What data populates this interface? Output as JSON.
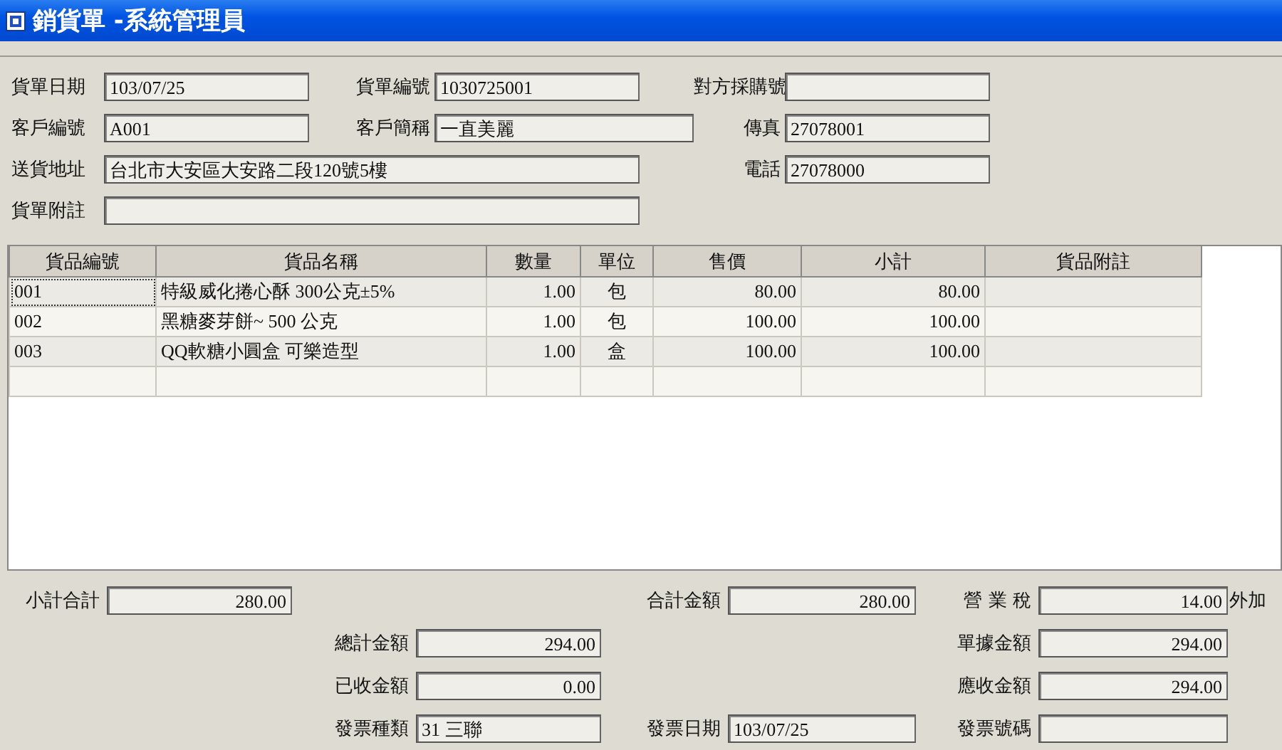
{
  "window": {
    "title": "銷貨單 -系統管理員"
  },
  "header": {
    "fields": [
      {
        "label": "貨單日期",
        "value": "103/07/25"
      },
      {
        "label": "貨單編號",
        "value": "1030725001"
      },
      {
        "label": "對方採購號"
      },
      {
        "label": "客戶編號",
        "value": "A001"
      },
      {
        "label": "客戶簡稱",
        "value": "一直美麗"
      },
      {
        "label": "傳真",
        "value": "27078001"
      },
      {
        "label": "送貨地址",
        "value": "台北市大安區大安路二段120號5樓"
      },
      {
        "label": "電話",
        "value": "27078000"
      },
      {
        "label": "貨單附註"
      }
    ]
  },
  "table": {
    "columns": [
      "貨品編號",
      "貨品名稱",
      "數量",
      "單位",
      "售價",
      "小計",
      "貨品附註"
    ],
    "rows": [
      {
        "cells": [
          "001",
          "特級威化捲心酥 300公克±5%",
          "1.00",
          "包",
          "80.00",
          "80.00",
          ""
        ],
        "focused": true
      },
      {
        "cells": [
          "002",
          "黑糖麥芽餅~ 500 公克",
          "1.00",
          "包",
          "100.00",
          "100.00",
          ""
        ],
        "focused": false
      },
      {
        "cells": [
          "003",
          "QQ軟糖小圓盒 可樂造型",
          "1.00",
          "盒",
          "100.00",
          "100.00",
          ""
        ],
        "focused": false
      },
      {
        "cells": [
          "",
          "",
          "",
          "",
          "",
          "",
          ""
        ],
        "focused": false
      }
    ]
  },
  "footer": {
    "fields": [
      {
        "label": "小計合計",
        "value": "280.00",
        "kind": "amount"
      },
      {
        "label": "合計金額",
        "value": "280.00",
        "kind": "amount"
      },
      {
        "label": "營 業 稅",
        "value": "14.00",
        "kind": "amount",
        "suffix": "外加"
      },
      {
        "label": "總計金額",
        "value": "294.00",
        "kind": "amount"
      },
      {
        "label": "單據金額",
        "value": "294.00",
        "kind": "amount"
      },
      {
        "label": "已收金額",
        "value": "0.00",
        "kind": "amount"
      },
      {
        "label": "應收金額",
        "value": "294.00",
        "kind": "amount"
      },
      {
        "label": "發票種類",
        "value": "31 三聯",
        "kind": "text"
      },
      {
        "label": "發票日期",
        "value": "103/07/25",
        "kind": "text"
      },
      {
        "label": "發票號碼",
        "kind": "text"
      }
    ]
  }
}
